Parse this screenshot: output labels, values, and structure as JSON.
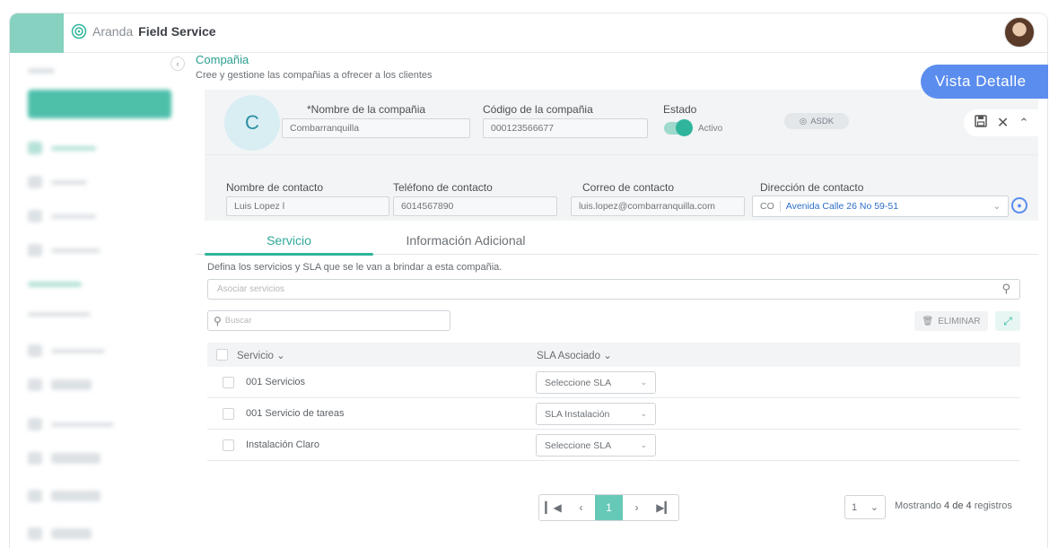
{
  "app": {
    "brand_light": "Aranda",
    "brand_bold": "Field Service"
  },
  "colors": {
    "accent": "#2fb59c",
    "primary_blue": "#5b8def",
    "panel_bg": "#f3f4f5"
  },
  "page": {
    "title": "Compañia",
    "subtitle": "Cree y gestione las compañias  a ofrecer a los clientes",
    "vista_label": "Vista Detalle"
  },
  "company": {
    "initial": "C",
    "name_label": "*Nombre  de la compañia",
    "name_value": "Combarranquilla",
    "code_label": "Código de la compañia",
    "code_value": "000123566677",
    "state_label": "Estado",
    "state_value": "Activo",
    "badge": "ASDK"
  },
  "contact": {
    "name_label": "Nombre de contacto",
    "name_value": "Luis Lopez l",
    "phone_label": "Teléfono de contacto",
    "phone_value": "6014567890",
    "email_label": "Correo de contacto",
    "email_value": "luis.lopez@combarranquilla.com",
    "address_label": "Dirección de contacto",
    "address_country": "CO",
    "address_value": "Avenida Calle 26 No 59-51"
  },
  "tabs": [
    {
      "label": "Servicio",
      "active": true
    },
    {
      "label": "Información Adicional",
      "active": false
    }
  ],
  "services": {
    "description": "Defina los servicios y SLA que se le van a brindar a esta compañia.",
    "associate_placeholder": "Asociar servicios",
    "search_placeholder": "Buscar",
    "delete_label": "ELIMINAR",
    "col_service": "Servicio",
    "col_sla": "SLA Asociado",
    "rows": [
      {
        "service": "001 Servicios",
        "sla": "Seleccione SLA"
      },
      {
        "service": "001 Servicio de tareas",
        "sla": "SLA Instalación"
      },
      {
        "service": "Instalación Claro",
        "sla": "Seleccione SLA"
      }
    ]
  },
  "pagination": {
    "current_page": "1",
    "per_page": "1",
    "showing_prefix": "Mostrando",
    "showing_count": "4 de 4",
    "showing_suffix": "registros"
  }
}
